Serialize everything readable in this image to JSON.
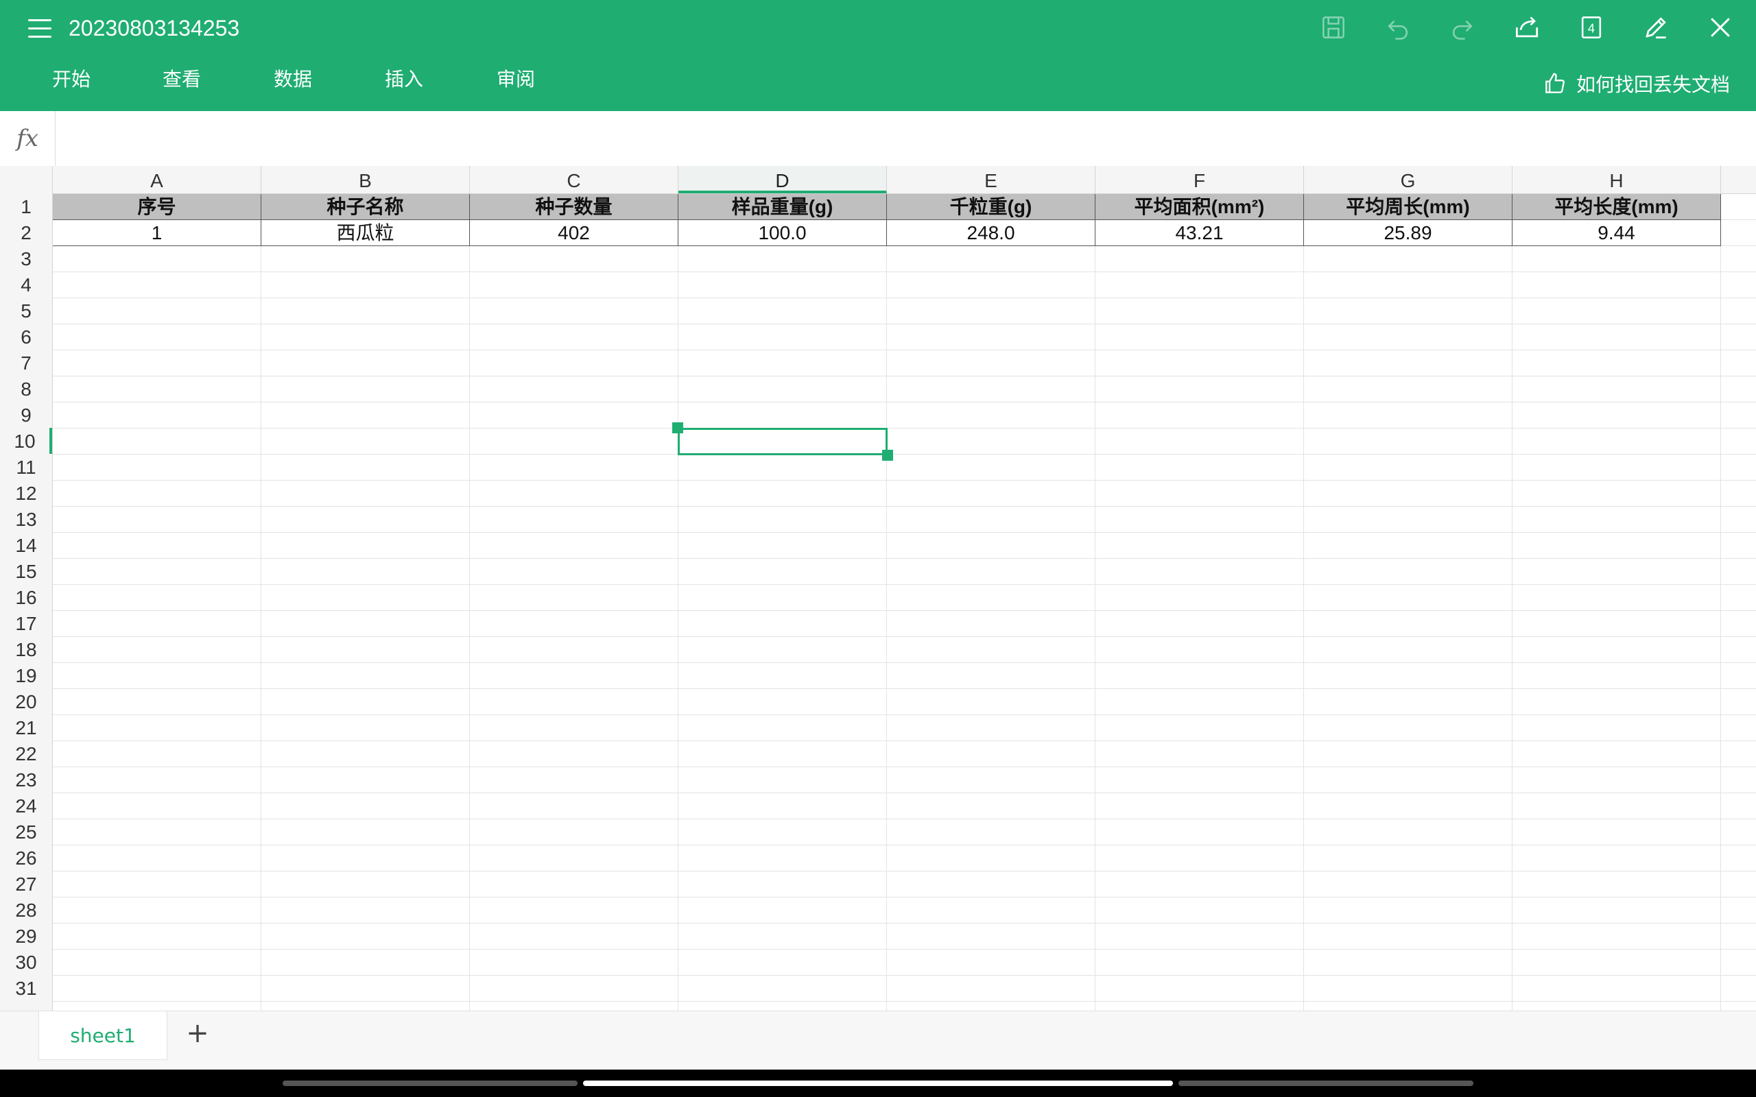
{
  "app": {
    "title": "20230803134253",
    "accent_color": "#1fad72"
  },
  "toolbar": {
    "icons": [
      "menu-icon",
      "save-icon",
      "undo-icon",
      "redo-icon",
      "share-icon",
      "window-count-icon",
      "edit-icon",
      "close-icon"
    ],
    "window_count": "4"
  },
  "tabs": [
    {
      "label": "开始"
    },
    {
      "label": "查看"
    },
    {
      "label": "数据"
    },
    {
      "label": "插入"
    },
    {
      "label": "审阅"
    }
  ],
  "help": {
    "label": "如何找回丢失文档"
  },
  "formula": {
    "fx_label": "fx",
    "value": ""
  },
  "columns": [
    "A",
    "B",
    "C",
    "D",
    "E",
    "F",
    "G",
    "H"
  ],
  "rows": [
    "1",
    "2",
    "3",
    "4",
    "5",
    "6",
    "7",
    "8",
    "9",
    "10",
    "11",
    "12",
    "13",
    "14",
    "15",
    "16",
    "17",
    "18",
    "19",
    "20",
    "21",
    "22",
    "23",
    "24",
    "25",
    "26",
    "27",
    "28",
    "29",
    "30",
    "31"
  ],
  "table": {
    "headers": [
      "序号",
      "种子名称",
      "种子数量",
      "样品重量(g)",
      "千粒重(g)",
      "平均面积(mm²)",
      "平均周长(mm)",
      "平均长度(mm)"
    ],
    "rows": [
      [
        "1",
        "西瓜粒",
        "402",
        "100.0",
        "248.0",
        "43.21",
        "25.89",
        "9.44"
      ]
    ]
  },
  "selection": {
    "cell": "D10"
  },
  "sheets": [
    {
      "label": "sheet1"
    }
  ],
  "add_sheet_label": "+"
}
